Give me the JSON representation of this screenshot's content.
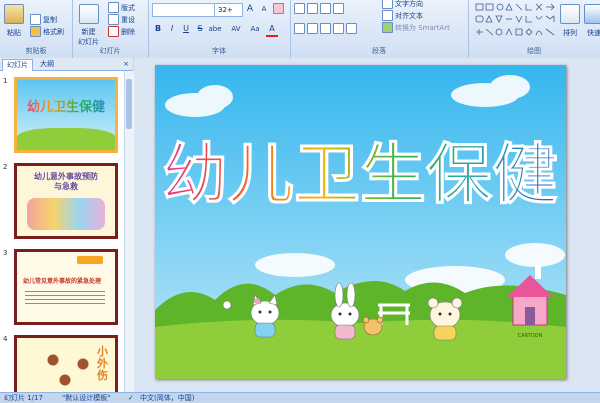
{
  "ribbon": {
    "clipboard": {
      "paste": "粘贴",
      "copy": "复制",
      "format_painter": "格式刷",
      "label": "剪贴板"
    },
    "slides": {
      "new_slide": "新建",
      "new_slide2": "幻灯片",
      "layout": "版式",
      "reset": "重设",
      "delete": "删除",
      "label": "幻灯片"
    },
    "font": {
      "font_size": "32+",
      "grow": "A",
      "shrink": "A",
      "bold": "B",
      "italic": "I",
      "underline": "U",
      "strike": "S",
      "shadow": "abe",
      "spacing": "AV",
      "case": "Aa",
      "color": "A",
      "label": "字体"
    },
    "paragraph": {
      "text_direction": "文字方向",
      "align_text": "对齐文本",
      "smartart": "转换为 SmartArt",
      "label": "段落"
    },
    "drawing": {
      "arrange": "排列",
      "quick_styles": "快速",
      "label": "绘图"
    }
  },
  "pane_tabs": {
    "slides": "幻灯片",
    "outline": "大纲"
  },
  "thumbnails": [
    {
      "num": "1",
      "title": "幼儿卫生保健"
    },
    {
      "num": "2",
      "title": "幼儿意外事故预防与急救"
    },
    {
      "num": "3",
      "title": "幼儿常见意外事故的紧急处理"
    },
    {
      "num": "4",
      "title": "小外伤"
    }
  ],
  "slide": {
    "title": "幼儿卫生保健",
    "watermark": "CARTOON"
  },
  "status": {
    "slide_info": "幻灯片 1/17",
    "theme": "\"默认设计模板\"",
    "language": "中文(简体，中国)"
  },
  "colors": {
    "sky_top": "#35b6ee",
    "sky_bottom": "#bfe9f8",
    "grass": "#8fcd3a",
    "ribbon_text": "#15428b",
    "thumb_frame": "#7b1d1d",
    "thumb_selected": "#f6b23c"
  }
}
